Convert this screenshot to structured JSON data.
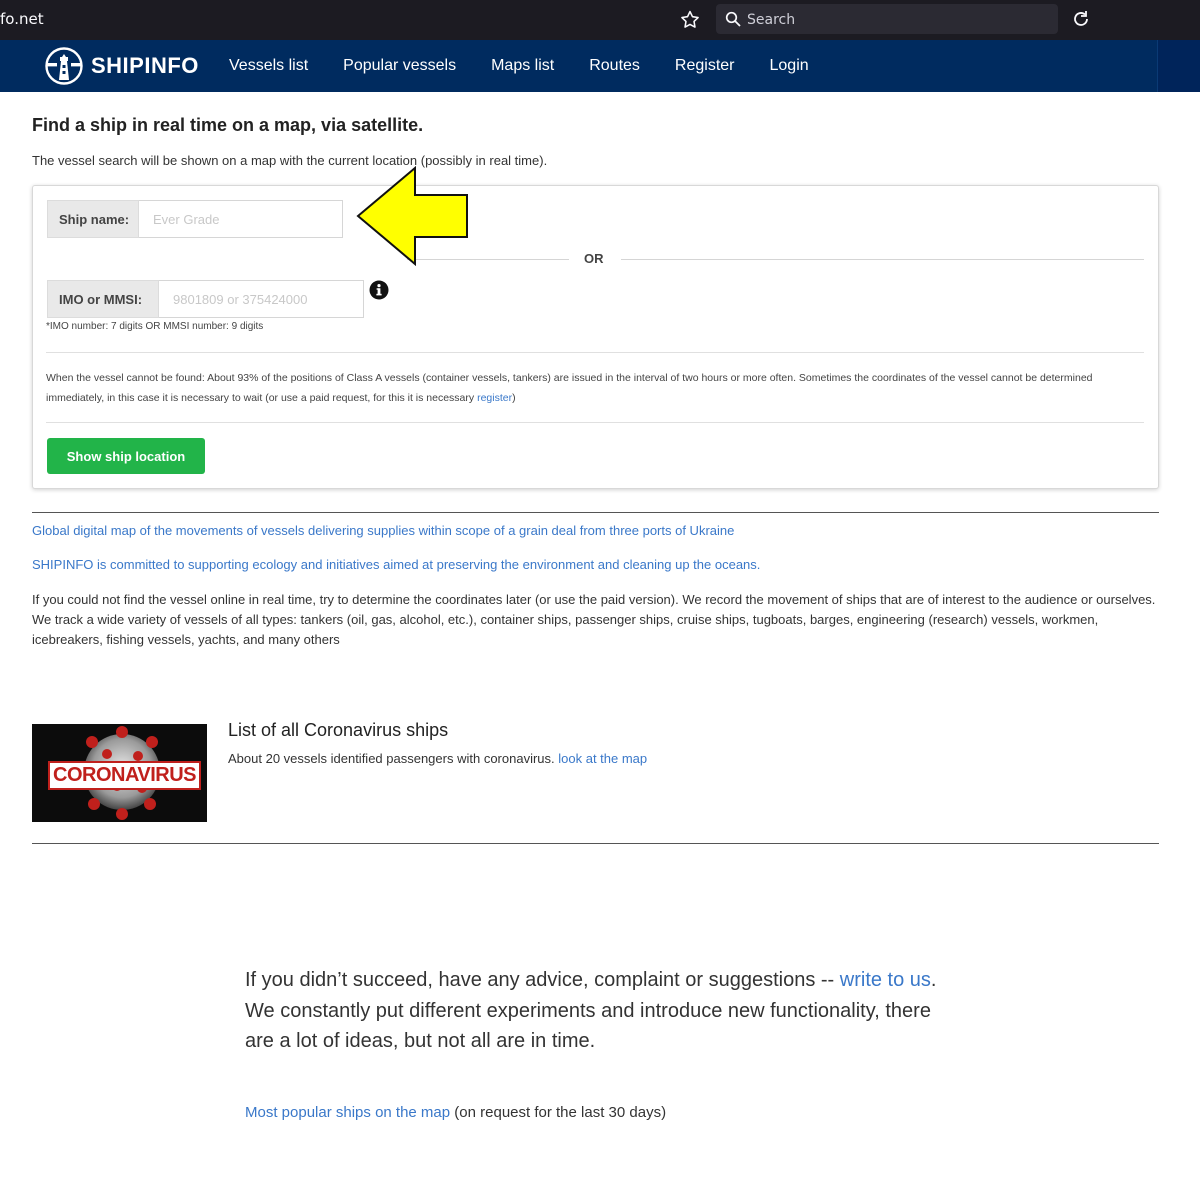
{
  "browser": {
    "url": "fo.net",
    "search_placeholder": "Search"
  },
  "header": {
    "logo_text": "SHIPINFO",
    "nav": [
      {
        "label": "Vessels list"
      },
      {
        "label": "Popular vessels"
      },
      {
        "label": "Maps list"
      },
      {
        "label": "Routes"
      },
      {
        "label": "Register"
      },
      {
        "label": "Login"
      }
    ]
  },
  "main": {
    "title": "Find a ship in real time on a map, via satellite.",
    "intro": "The vessel search will be shown on a map with the current location (possibly in real time).",
    "form": {
      "ship_label": "Ship name:",
      "ship_placeholder": "Ever Grade",
      "or": "OR",
      "imo_label": "IMO or MMSI:",
      "imo_placeholder": "9801809 or 375424000",
      "hint": "*IMO number: 7 digits OR MMSI number: 9 digits",
      "notice_text": "When the vessel cannot be found: About 93% of the positions of Class A vessels (container vessels, tankers) are issued in the interval of two hours or more often. Sometimes the coordinates of the vessel cannot be determined immediately, in this case it is necessary to wait (or use a paid request, for this it is necessary ",
      "notice_link": "register",
      "notice_end": ")",
      "button": "Show ship location"
    },
    "link_grain": "Global digital map of the movements of vessels delivering supplies within scope of a grain deal from three ports of Ukraine",
    "link_ecology": "SHIPINFO is committed to supporting ecology and initiatives aimed at preserving the environment and cleaning up the oceans.",
    "paragraph": "If you could not find the vessel online in real time, try to determine the coordinates later (or use the paid version). We record the movement of ships that are of interest to the audience or ourselves. We track a wide variety of vessels of all types: tankers (oil, gas, alcohol, etc.), container ships, passenger ships, cruise ships, tugboats, barges, engineering (research) vessels, workmen, icebreakers, fishing vessels, yachts, and many others",
    "corona": {
      "image_text": "CORONAVIRUS",
      "title": "List of all Coronavirus ships",
      "desc": "About 20 vessels identified passengers with coronavirus. ",
      "link": "look at the map"
    }
  },
  "footer": {
    "text_start": "If you didn’t succeed, have any advice, complaint or suggestions -- ",
    "write_link": "write to us",
    "text_end": ". We constantly put different experiments and introduce new functionality, there are a lot of ideas, but not all are in time.",
    "popular_link": "Most popular ships on the map",
    "popular_suffix": " (on request for the last 30 days)"
  },
  "colors": {
    "header_bg": "#002b5f",
    "link": "#3a78c9",
    "button": "#22b449",
    "arrow": "#ffff00"
  }
}
